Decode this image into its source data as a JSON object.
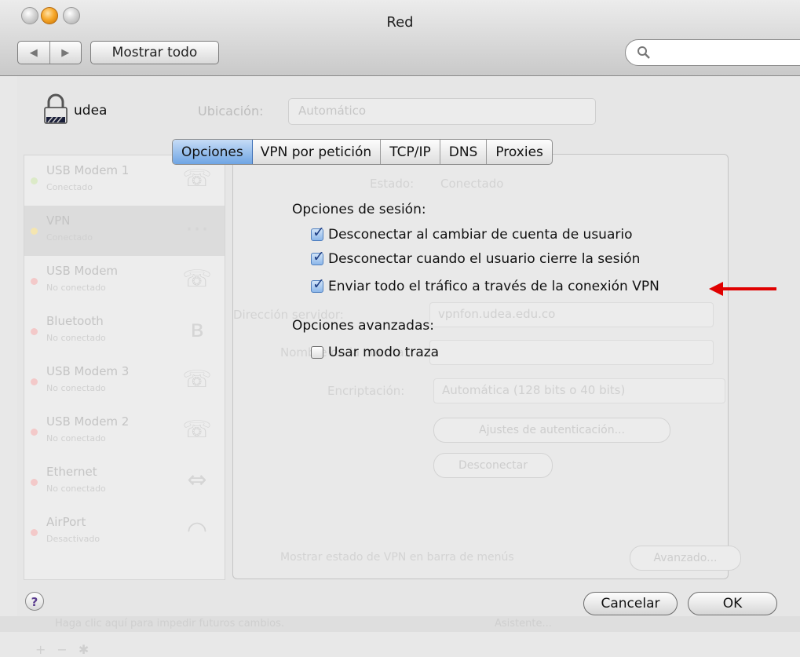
{
  "window": {
    "title": "Red"
  },
  "toolbar": {
    "back": "◀",
    "forward": "▶",
    "show_all": "Mostrar todo",
    "search_placeholder": ""
  },
  "profile": {
    "name": "udea"
  },
  "background": {
    "location_label": "Ubicación:",
    "location_value": "Automático",
    "sidebar_items": [
      {
        "name": "USB Modem 1",
        "status": "Conectado",
        "dot": "green"
      },
      {
        "name": "VPN",
        "status": "Conectado",
        "dot": "amber"
      },
      {
        "name": "USB Modem",
        "status": "No conectado",
        "dot": "red"
      },
      {
        "name": "Bluetooth",
        "status": "No conectado",
        "dot": "red"
      },
      {
        "name": "USB Modem 3",
        "status": "No conectado",
        "dot": "red"
      },
      {
        "name": "USB Modem 2",
        "status": "No conectado",
        "dot": "red"
      },
      {
        "name": "Ethernet",
        "status": "No conectado",
        "dot": "red"
      },
      {
        "name": "AirPort",
        "status": "Desactivado",
        "dot": "red"
      }
    ],
    "status_label": "Estado:",
    "status_value": "Conectado",
    "server_label": "Dirección servidor:",
    "server_value": "vpnfon.udea.edu.co",
    "account_label": "Nombre de la cuenta:",
    "encryption_label": "Encriptación:",
    "encryption_value": "Automática (128 bits o 40 bits)",
    "auth_button": "Ajustes de autenticación...",
    "disconnect_button": "Desconectar",
    "show_vpn_status": "Mostrar estado de VPN en barra de menús",
    "advanced_button": "Avanzado...",
    "lock_hint": "Haga clic aquí para impedir futuros cambios.",
    "assistant_button": "Asistente..."
  },
  "tabs": [
    {
      "label": "Opciones",
      "active": true
    },
    {
      "label": "VPN por petición",
      "active": false
    },
    {
      "label": "TCP/IP",
      "active": false
    },
    {
      "label": "DNS",
      "active": false
    },
    {
      "label": "Proxies",
      "active": false
    }
  ],
  "session_options": {
    "title": "Opciones de sesión:",
    "items": [
      {
        "label": "Desconectar al cambiar de cuenta de usuario",
        "checked": true
      },
      {
        "label": "Desconectar cuando el usuario cierre la sesión",
        "checked": true
      },
      {
        "label": "Enviar todo el tráfico a través de la conexión VPN",
        "checked": true
      }
    ]
  },
  "advanced_options": {
    "title": "Opciones avanzadas:",
    "items": [
      {
        "label": "Usar modo traza",
        "checked": false
      }
    ]
  },
  "help": {
    "label": "?"
  },
  "buttons": {
    "cancel": "Cancelar",
    "ok": "OK"
  },
  "colors": {
    "accent": "#6fa5e4",
    "arrow": "#e00000"
  }
}
